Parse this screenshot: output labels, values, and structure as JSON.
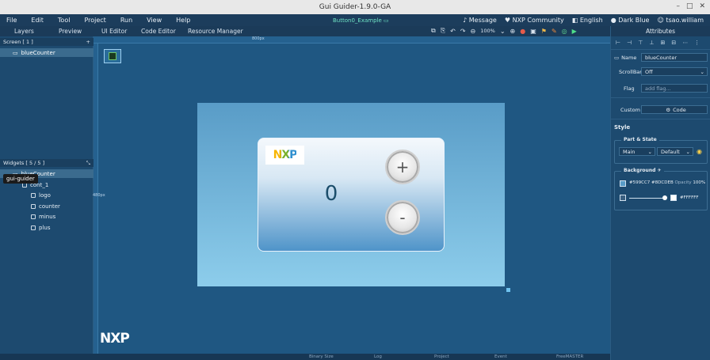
{
  "window": {
    "title": "Gui Guider-1.9.0-GA"
  },
  "menubar": {
    "items": [
      "File",
      "Edit",
      "Tool",
      "Project",
      "Run",
      "View",
      "Help"
    ],
    "project_name": "Button0_Example",
    "right": {
      "message": "Message",
      "community": "NXP Community",
      "language": "English",
      "theme": "Dark Blue",
      "user": "tsao.william"
    }
  },
  "tabs": {
    "left": [
      "Layers",
      "Preview"
    ],
    "center": [
      "UI Editor",
      "Code Editor",
      "Resource Manager"
    ],
    "zoom": "100%",
    "right": "Attributes"
  },
  "screens": {
    "header": "Screen [ 1 ]",
    "add_label": "+",
    "items": [
      "blueCounter"
    ]
  },
  "widgets": {
    "header": "Widgets [ 5 / 5 ]",
    "tooltip": "gui-guider",
    "tree": [
      {
        "label": "blueCounter",
        "level": 0
      },
      {
        "label": "cont_1",
        "level": 1
      },
      {
        "label": "logo",
        "level": 2
      },
      {
        "label": "counter",
        "level": 2
      },
      {
        "label": "minus",
        "level": 2
      },
      {
        "label": "plus",
        "level": 2
      }
    ]
  },
  "canvas": {
    "ruler_top_label": "800px",
    "ruler_left_label": "480px",
    "logo_text": "NXP",
    "counter_value": "0",
    "plus_label": "+",
    "minus_label": "-",
    "watermark": "NXP"
  },
  "statusbar": [
    "Binary Size",
    "Log",
    "Project",
    "Event",
    "FreeMASTER"
  ],
  "attributes": {
    "name_label": "Name",
    "name_value": "blueCounter",
    "scrollbar_label": "ScrollBar",
    "scrollbar_value": "Off",
    "flag_label": "Flag",
    "flag_placeholder": "add flag...",
    "custom_label": "Custom",
    "code_label": "Code",
    "style_title": "Style",
    "part_state_title": "Part & State",
    "part_value": "Main",
    "state_value": "Default",
    "background_title": "Background",
    "bg_color_1": "#599CC7",
    "bg_color_2": "#8DCDEB",
    "opacity_label": "Opacity",
    "opacity_value": "100%",
    "bg_color_3": "#FFFFFF"
  },
  "colors": {
    "bg1": "#599CC7",
    "bg2": "#8DCDEB",
    "white": "#FFFFFF",
    "accent": "#6FE3C4"
  }
}
